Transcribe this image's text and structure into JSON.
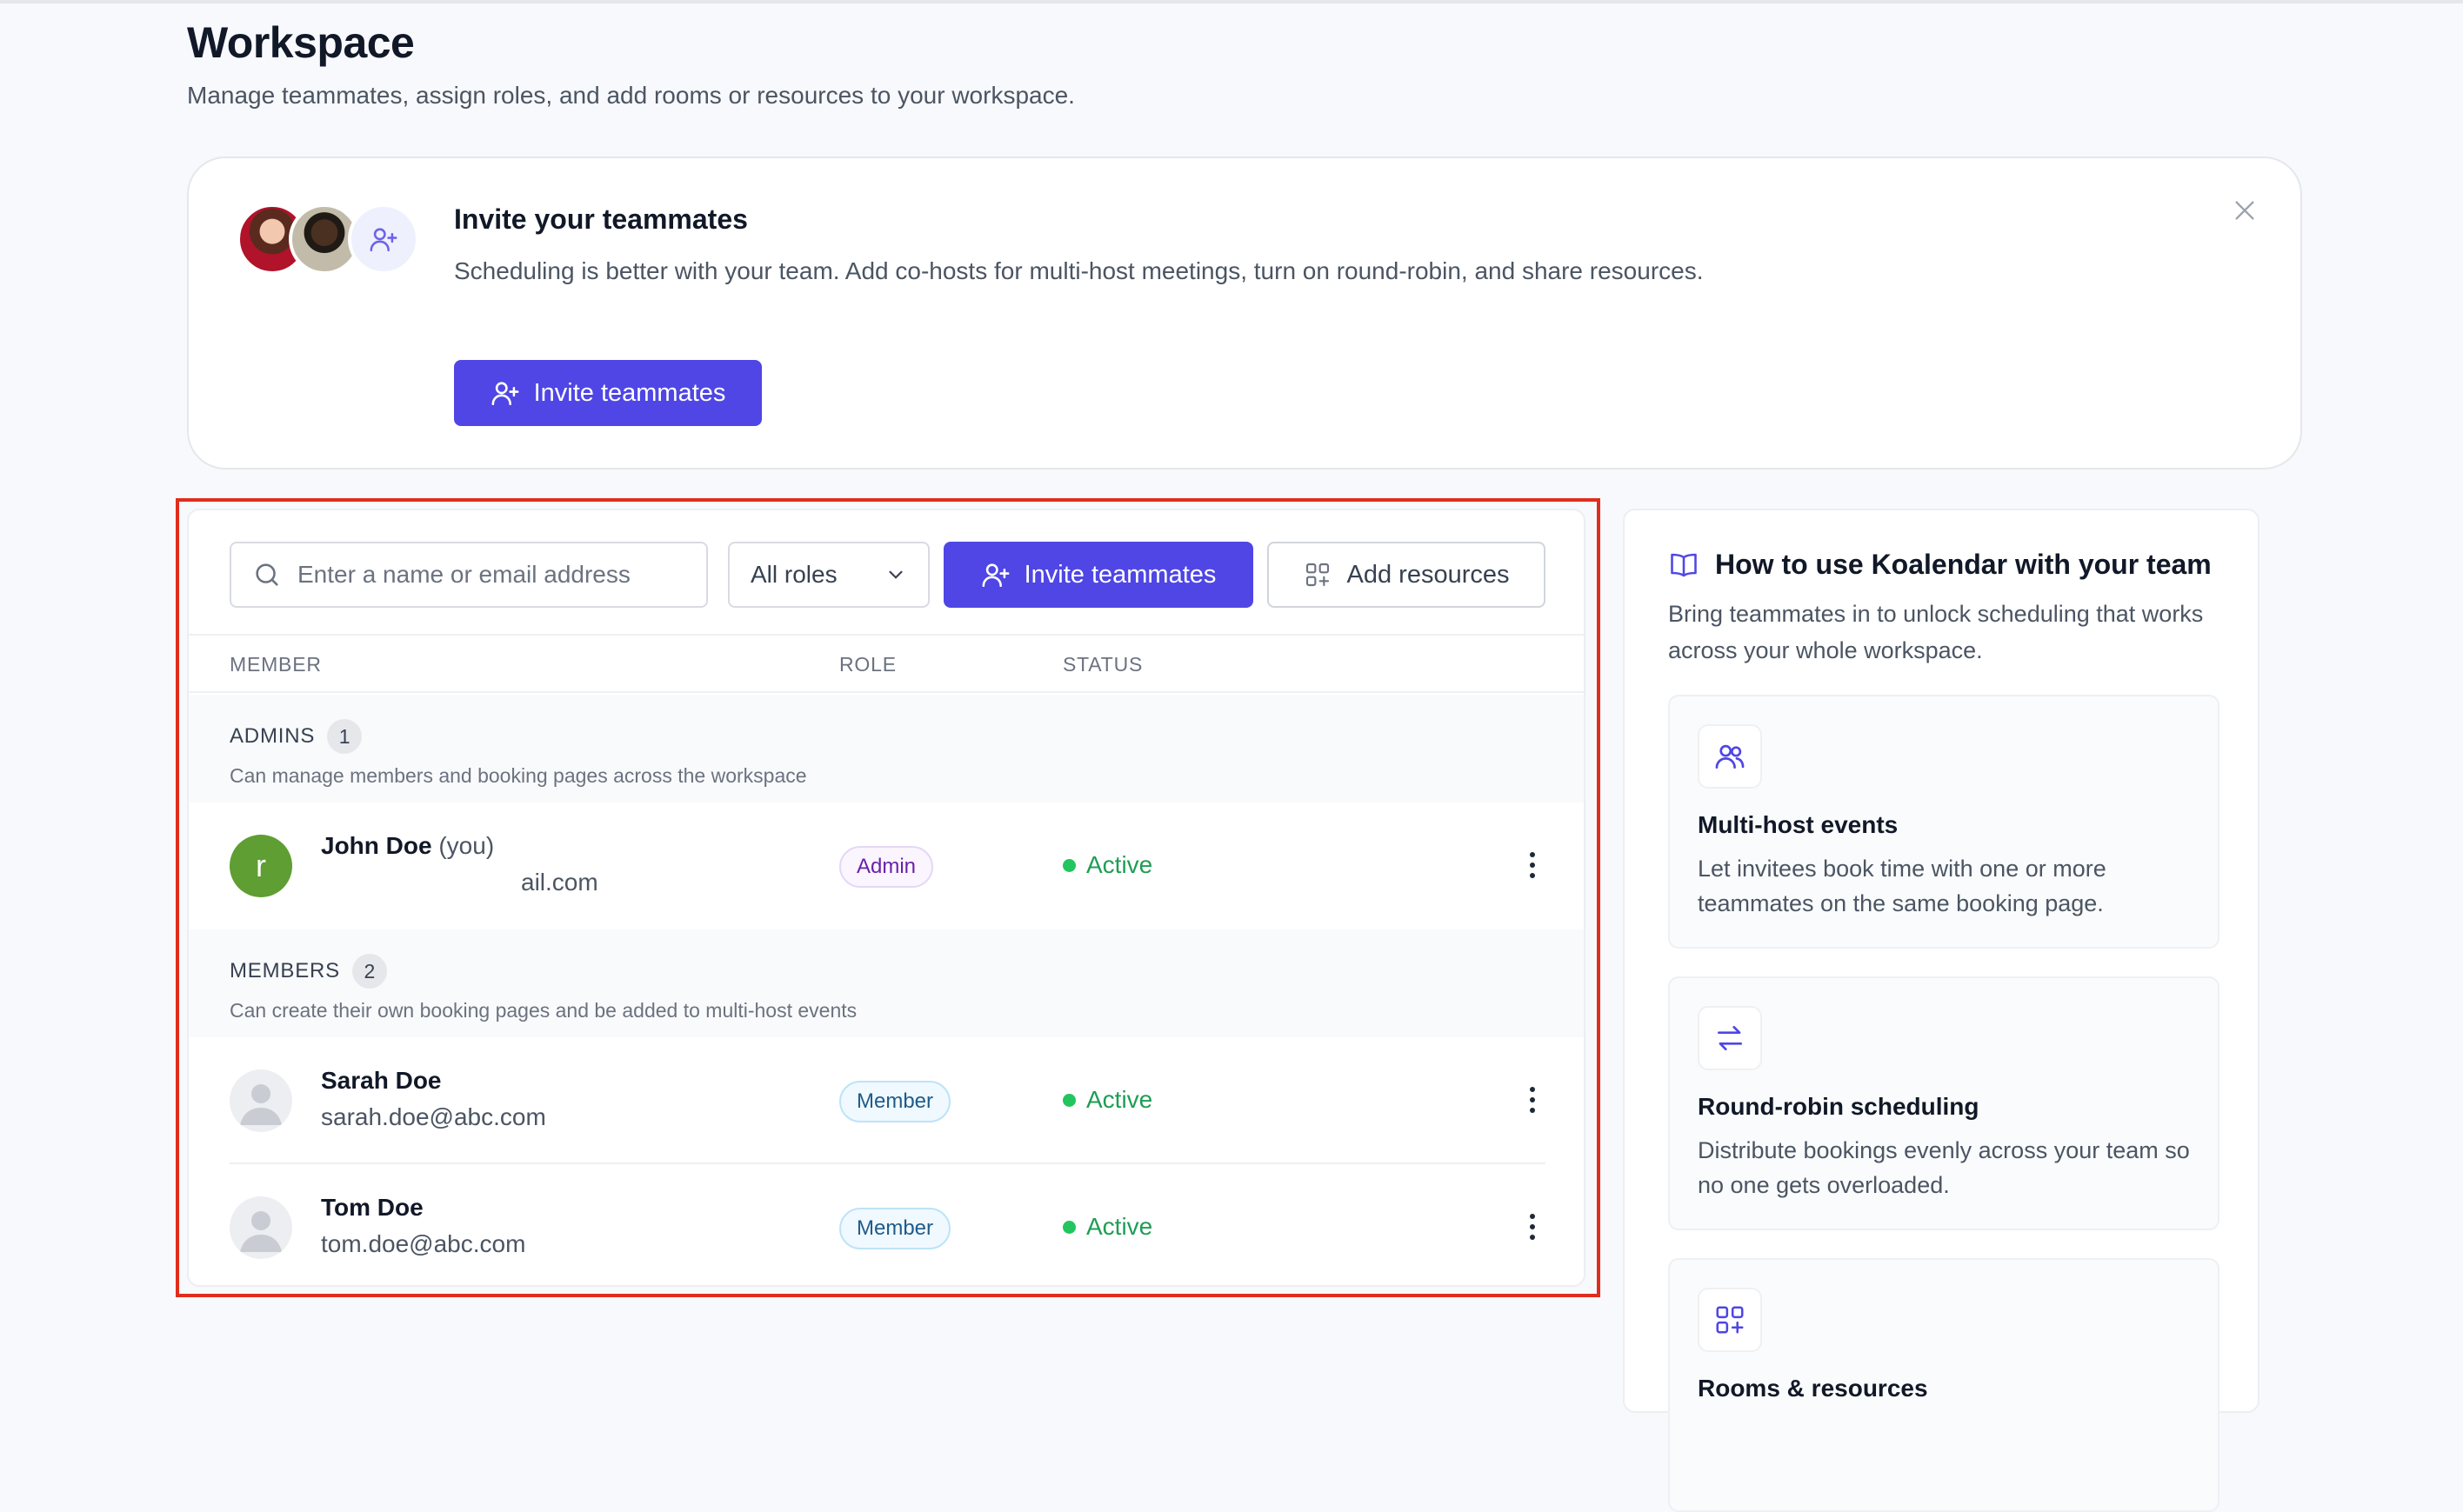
{
  "header": {
    "title": "Workspace",
    "subtitle": "Manage teammates, assign roles, and add rooms or resources to your workspace."
  },
  "banner": {
    "title": "Invite your teammates",
    "text": "Scheduling is better with your team. Add co-hosts for multi-host meetings, turn on round-robin, and share resources.",
    "button_label": "Invite teammates"
  },
  "toolbar": {
    "search_placeholder": "Enter a name or email address",
    "roles_selected": "All roles",
    "invite_label": "Invite teammates",
    "resources_label": "Add resources"
  },
  "table": {
    "columns": [
      "MEMBER",
      "ROLE",
      "STATUS"
    ],
    "groups": [
      {
        "title": "ADMINS",
        "count": "1",
        "description": "Can manage members and booking pages across the workspace",
        "rows": [
          {
            "name": "John Doe",
            "suffix": "(you)",
            "email": "ail.com",
            "avatar_initial": "r",
            "role": "Admin",
            "status": "Active"
          }
        ]
      },
      {
        "title": "MEMBERS",
        "count": "2",
        "description": "Can create their own booking pages and be added to multi-host events",
        "rows": [
          {
            "name": "Sarah Doe",
            "email": "sarah.doe@abc.com",
            "role": "Member",
            "status": "Active"
          },
          {
            "name": "Tom Doe",
            "email": "tom.doe@abc.com",
            "role": "Member",
            "status": "Active"
          }
        ]
      }
    ]
  },
  "guide": {
    "title": "How to use Koalendar with your team",
    "text": "Bring teammates in to unlock scheduling that works across your whole workspace.",
    "cards": [
      {
        "icon": "users-icon",
        "title": "Multi-host events",
        "text": "Let invitees book time with one or more teammates on the same booking page."
      },
      {
        "icon": "arrows-swap-icon",
        "title": "Round-robin scheduling",
        "text": "Distribute bookings evenly across your team so no one gets overloaded."
      },
      {
        "icon": "resources-grid-icon",
        "title": "Rooms & resources",
        "text": ""
      }
    ]
  },
  "colors": {
    "primary": "#4f46e5",
    "active": "#22c55e",
    "admin_badge": "#6b21a8",
    "member_badge": "#1e5b8a",
    "highlight": "#e02d1d"
  }
}
